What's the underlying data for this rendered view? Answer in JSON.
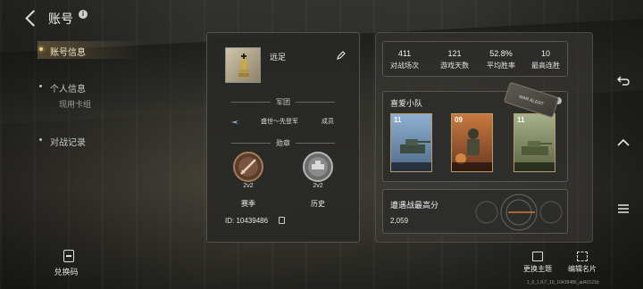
{
  "header": {
    "title": "账号"
  },
  "nav": {
    "items": [
      {
        "label": "账号信息",
        "active": true,
        "sub": []
      },
      {
        "label": "个人信息",
        "active": false,
        "sub": [
          "现用卡组"
        ]
      },
      {
        "label": "对战记录",
        "active": false,
        "sub": []
      }
    ]
  },
  "redeem": {
    "label": "兑换码"
  },
  "profile": {
    "name": "远足",
    "legion_section": "军团",
    "legion_name": "盛世～先登军",
    "legion_role": "成员",
    "medal_section": "勋章",
    "medals": [
      {
        "count": "2v2",
        "label": "赛季"
      },
      {
        "count": "2v2",
        "label": "历史"
      }
    ],
    "uid": "ID: 10439486"
  },
  "stats": [
    {
      "value": "411",
      "label": "对战场次"
    },
    {
      "value": "121",
      "label": "游戏天数"
    },
    {
      "value": "52.8%",
      "label": "平均胜率"
    },
    {
      "value": "10",
      "label": "最高连胜"
    }
  ],
  "squad": {
    "title": "喜爱小队",
    "cards": [
      {
        "level": "11",
        "color": "#6a8ab0"
      },
      {
        "level": "09",
        "color": "#b0643a"
      },
      {
        "level": "11",
        "color": "#7a8a5a"
      }
    ],
    "dogtag": "WAR ALERT"
  },
  "score": {
    "title": "遭遇战最高分",
    "value": "2,059"
  },
  "actions": {
    "theme": "更换主题",
    "edit_card": "编辑名片"
  },
  "version": "1_0_1.8.7_10_10439486_ad42121b",
  "colors": {
    "accent": "#f0cf7a",
    "card_border": "#b59a6a"
  }
}
